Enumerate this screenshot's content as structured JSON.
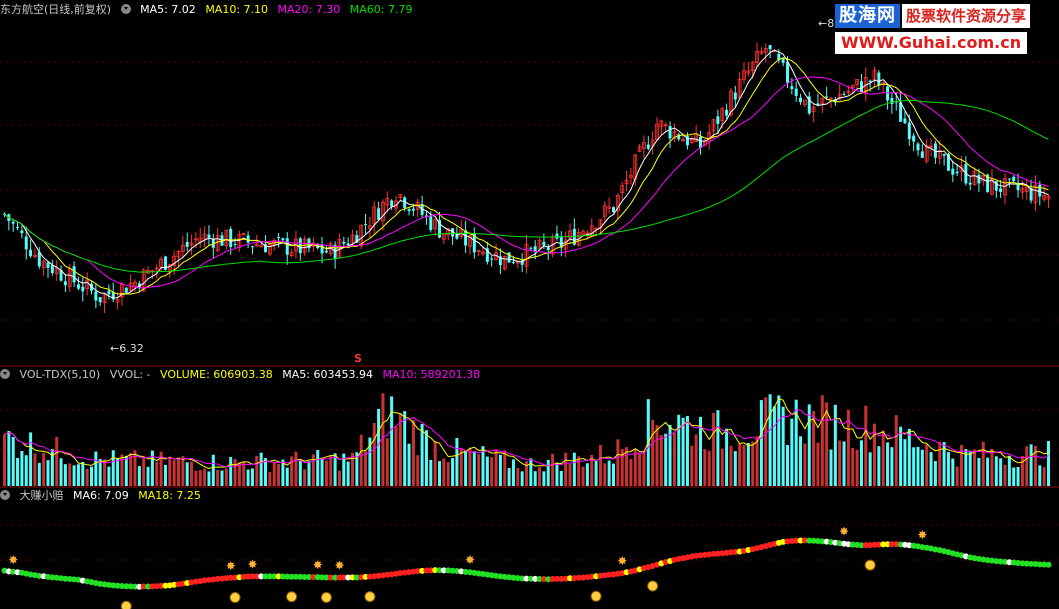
{
  "main": {
    "title": "东方航空(日线,前复权)",
    "ma5": "MA5: 7.02",
    "ma10": "MA10: 7.10",
    "ma20": "MA20: 7.30",
    "ma60": "MA60: 7.79",
    "low_label": "6.32",
    "high_label": "8",
    "s_marker": "S"
  },
  "vol": {
    "name": "VOL-TDX(5,10)",
    "vvol": "VVOL: -",
    "volume": "VOLUME: 606903.38",
    "ma5": "MA5: 603453.94",
    "ma10": "MA10: 589201.38"
  },
  "ind": {
    "name": "大赚小赔",
    "ma6": "MA6: 7.09",
    "ma18": "MA18: 7.25"
  },
  "logo": {
    "brand": "股海网",
    "slogan": "股票软件资源分享",
    "url": "WWW.Guhai.com.cn"
  },
  "colors": {
    "up": "#ff3232",
    "down": "#54fcfc",
    "ma5": "#ffffff",
    "ma10": "#ffff00",
    "ma20": "#ff00ff",
    "ma60": "#00e000"
  },
  "chart_data": {
    "type": "candlestick",
    "price_range": [
      6.32,
      8.0
    ],
    "price_anchors": [
      {
        "i": 0,
        "p": 6.9
      },
      {
        "i": 8,
        "p": 6.6
      },
      {
        "i": 22,
        "p": 6.35
      },
      {
        "i": 30,
        "p": 6.45
      },
      {
        "i": 45,
        "p": 6.75
      },
      {
        "i": 60,
        "p": 6.7
      },
      {
        "i": 75,
        "p": 6.65
      },
      {
        "i": 80,
        "p": 6.75
      },
      {
        "i": 90,
        "p": 7.05
      },
      {
        "i": 100,
        "p": 6.8
      },
      {
        "i": 115,
        "p": 6.6
      },
      {
        "i": 128,
        "p": 6.7
      },
      {
        "i": 140,
        "p": 6.95
      },
      {
        "i": 150,
        "p": 7.5
      },
      {
        "i": 160,
        "p": 7.35
      },
      {
        "i": 170,
        "p": 7.8
      },
      {
        "i": 175,
        "p": 8.0
      },
      {
        "i": 185,
        "p": 7.6
      },
      {
        "i": 200,
        "p": 7.8
      },
      {
        "i": 212,
        "p": 7.3
      },
      {
        "i": 225,
        "p": 7.1
      },
      {
        "i": 240,
        "p": 7.02
      }
    ],
    "volume_anchors": [
      {
        "i": 0,
        "v": 0.45
      },
      {
        "i": 20,
        "v": 0.25
      },
      {
        "i": 50,
        "v": 0.22
      },
      {
        "i": 80,
        "v": 0.25
      },
      {
        "i": 88,
        "v": 0.7
      },
      {
        "i": 100,
        "v": 0.35
      },
      {
        "i": 120,
        "v": 0.2
      },
      {
        "i": 140,
        "v": 0.3
      },
      {
        "i": 150,
        "v": 0.65
      },
      {
        "i": 165,
        "v": 0.5
      },
      {
        "i": 180,
        "v": 0.65
      },
      {
        "i": 200,
        "v": 0.55
      },
      {
        "i": 220,
        "v": 0.3
      },
      {
        "i": 240,
        "v": 0.3
      }
    ],
    "buy_markers": [
      2,
      52,
      57,
      72,
      77,
      107,
      142,
      193,
      211
    ],
    "sell_markers": [
      28,
      53,
      66,
      74,
      84,
      136,
      149,
      199
    ]
  }
}
